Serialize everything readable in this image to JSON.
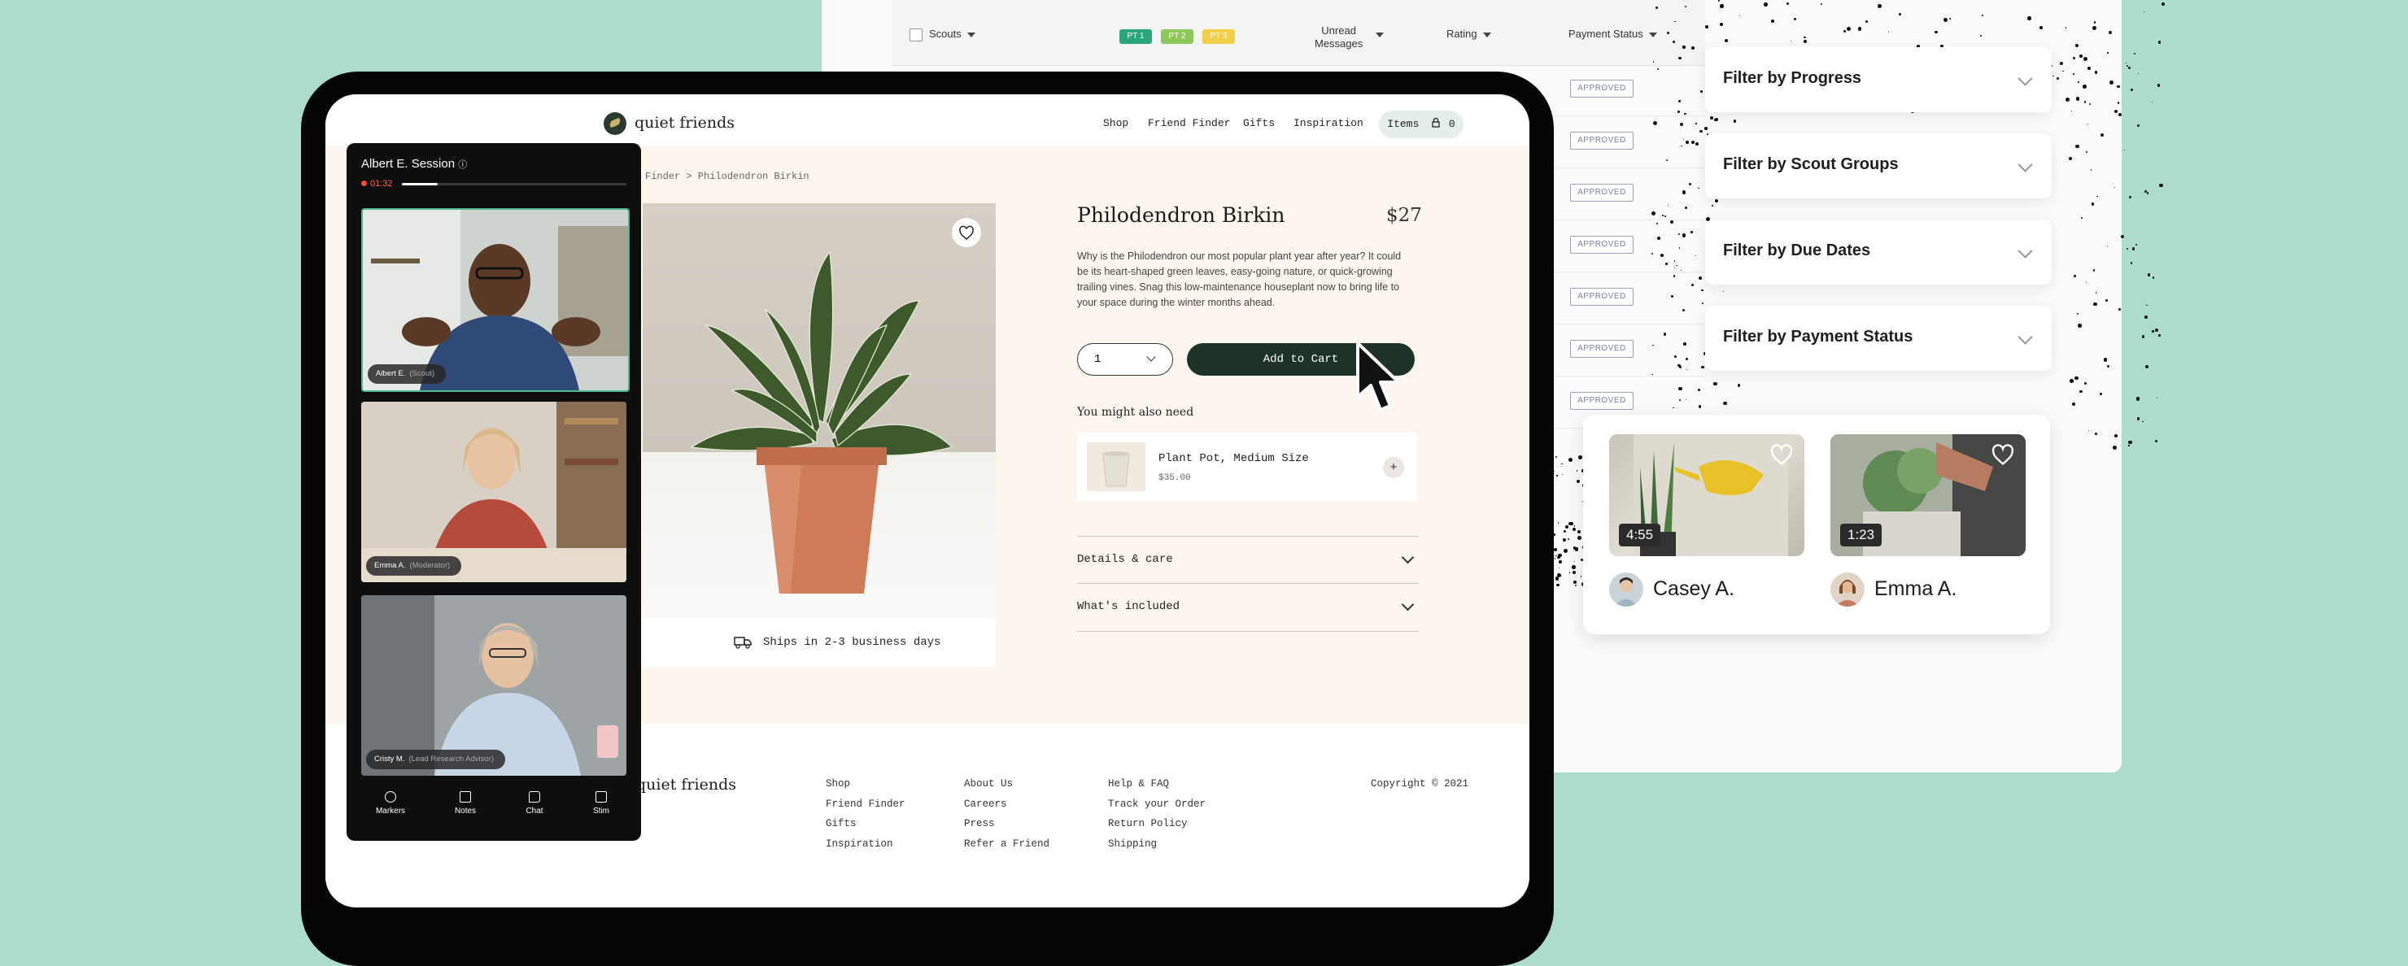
{
  "dashboard": {
    "select_all_label": "Scouts",
    "columns": [
      "Unread",
      "Messages",
      "Rating",
      "Payment Status"
    ],
    "pt_badges": [
      {
        "label": "PT 1",
        "color": "#2aa67e"
      },
      {
        "label": "PT 2",
        "color": "#8cc95a"
      },
      {
        "label": "PT 3",
        "color": "#f2cf4a"
      }
    ],
    "status_label": "APPROVED",
    "filters": [
      "Filter by Progress",
      "Filter by Scout Groups",
      "Filter by Due Dates",
      "Filter by Payment Status"
    ],
    "videos": [
      {
        "duration": "4:55",
        "name": "Casey A."
      },
      {
        "duration": "1:23",
        "name": "Emma A."
      }
    ]
  },
  "site": {
    "brand": "quiet friends",
    "nav": [
      "Shop",
      "Friend Finder",
      "Gifts",
      "Inspiration"
    ],
    "cart_label": "Items",
    "cart_count": "0",
    "breadcrumb": "Finder > Philodendron Birkin",
    "product": {
      "title": "Philodendron Birkin",
      "price": "$27",
      "description": "Why is the Philodendron our most popular plant year after year? It could be its heart-shaped green leaves, easy-going nature, or quick-growing trailing vines. Snag this low-maintenance houseplant now to bring life to your space during the winter months ahead.",
      "quantity": "1",
      "add_to_cart": "Add to Cart",
      "shipping": "Ships in 2-3 business days"
    },
    "upsell": {
      "heading": "You might also need",
      "item_name": "Plant Pot, Medium Size",
      "item_price": "$35.00"
    },
    "accordions": [
      "Details & care",
      "What's included"
    ],
    "footer": {
      "col1": [
        "Shop",
        "Friend Finder",
        "Gifts",
        "Inspiration"
      ],
      "col2": [
        "About Us",
        "Careers",
        "Press",
        "Refer a Friend"
      ],
      "col3": [
        "Help & FAQ",
        "Track your Order",
        "Return Policy",
        "Shipping"
      ],
      "copyright": "Copyright © 2021"
    }
  },
  "call": {
    "title": "Albert E. Session",
    "timer": "01:32",
    "progress": 0.16,
    "participants": [
      {
        "name": "Albert E.",
        "role": "(Scout)"
      },
      {
        "name": "Emma A.",
        "role": "(Moderator)"
      },
      {
        "name": "Cristy M.",
        "role": "(Lead Research Advisor)"
      }
    ],
    "toolbar": [
      "Markers",
      "Notes",
      "Chat",
      "Stim"
    ]
  }
}
